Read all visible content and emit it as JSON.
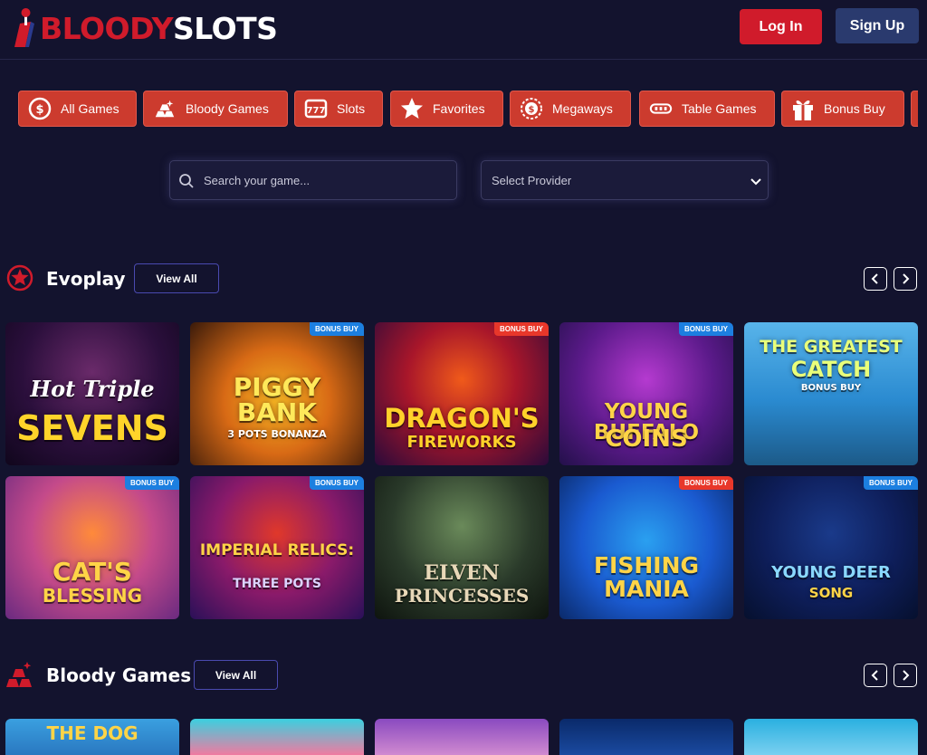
{
  "header": {
    "logo": {
      "part1": "BLOODY",
      "part2": "SLOTS"
    },
    "login_label": "Log In",
    "signup_label": "Sign Up"
  },
  "categories": [
    {
      "label": "All Games",
      "icon": "coin-icon"
    },
    {
      "label": "Bloody Games",
      "icon": "gold-bars-icon"
    },
    {
      "label": "Slots",
      "icon": "slot-machine-icon"
    },
    {
      "label": "Favorites",
      "icon": "star-icon"
    },
    {
      "label": "Megaways",
      "icon": "dollar-coin-icon"
    },
    {
      "label": "Table Games",
      "icon": "chips-icon"
    },
    {
      "label": "Bonus Buy",
      "icon": "gift-icon"
    }
  ],
  "search": {
    "placeholder": "Search your game..."
  },
  "provider_select": {
    "selected": "Select Provider"
  },
  "sections": [
    {
      "title": "Evoplay",
      "view_all": "View All",
      "games": [
        {
          "line1": "Hot Triple",
          "line2": "SEVENS",
          "badge": ""
        },
        {
          "line1": "PIGGY BANK",
          "line2": "3 POTS BONANZA",
          "badge": "BONUS BUY"
        },
        {
          "line1": "DRAGON'S",
          "line2": "FIREWORKS",
          "badge": "BONUS BUY"
        },
        {
          "line1": "YOUNG BUFFALO",
          "line2": "COINS",
          "badge": "BONUS BUY"
        },
        {
          "line1": "THE GREATEST",
          "line2": "CATCH",
          "extra": "BONUS BUY",
          "badge": ""
        },
        {
          "line1": "CAT'S",
          "line2": "BLESSING",
          "badge": "BONUS BUY"
        },
        {
          "line1": "IMPERIAL RELICS:",
          "line2": "THREE POTS",
          "badge": "BONUS BUY"
        },
        {
          "line1": "ELVEN",
          "line2": "PRINCESSES",
          "badge": ""
        },
        {
          "line1": "FISHING",
          "line2": "MANIA",
          "badge": "BONUS BUY"
        },
        {
          "line1": "YOUNG DEER",
          "line2": "SONG",
          "badge": "BONUS BUY"
        }
      ]
    },
    {
      "title": "Bloody Games",
      "view_all": "View All",
      "games": [
        {
          "line1": "THE DOG"
        }
      ]
    }
  ],
  "colors": {
    "background": "#13132e",
    "brand_red": "#d01b2b",
    "category_red": "#cc3b2e",
    "signup_blue": "#2a3a6e"
  }
}
